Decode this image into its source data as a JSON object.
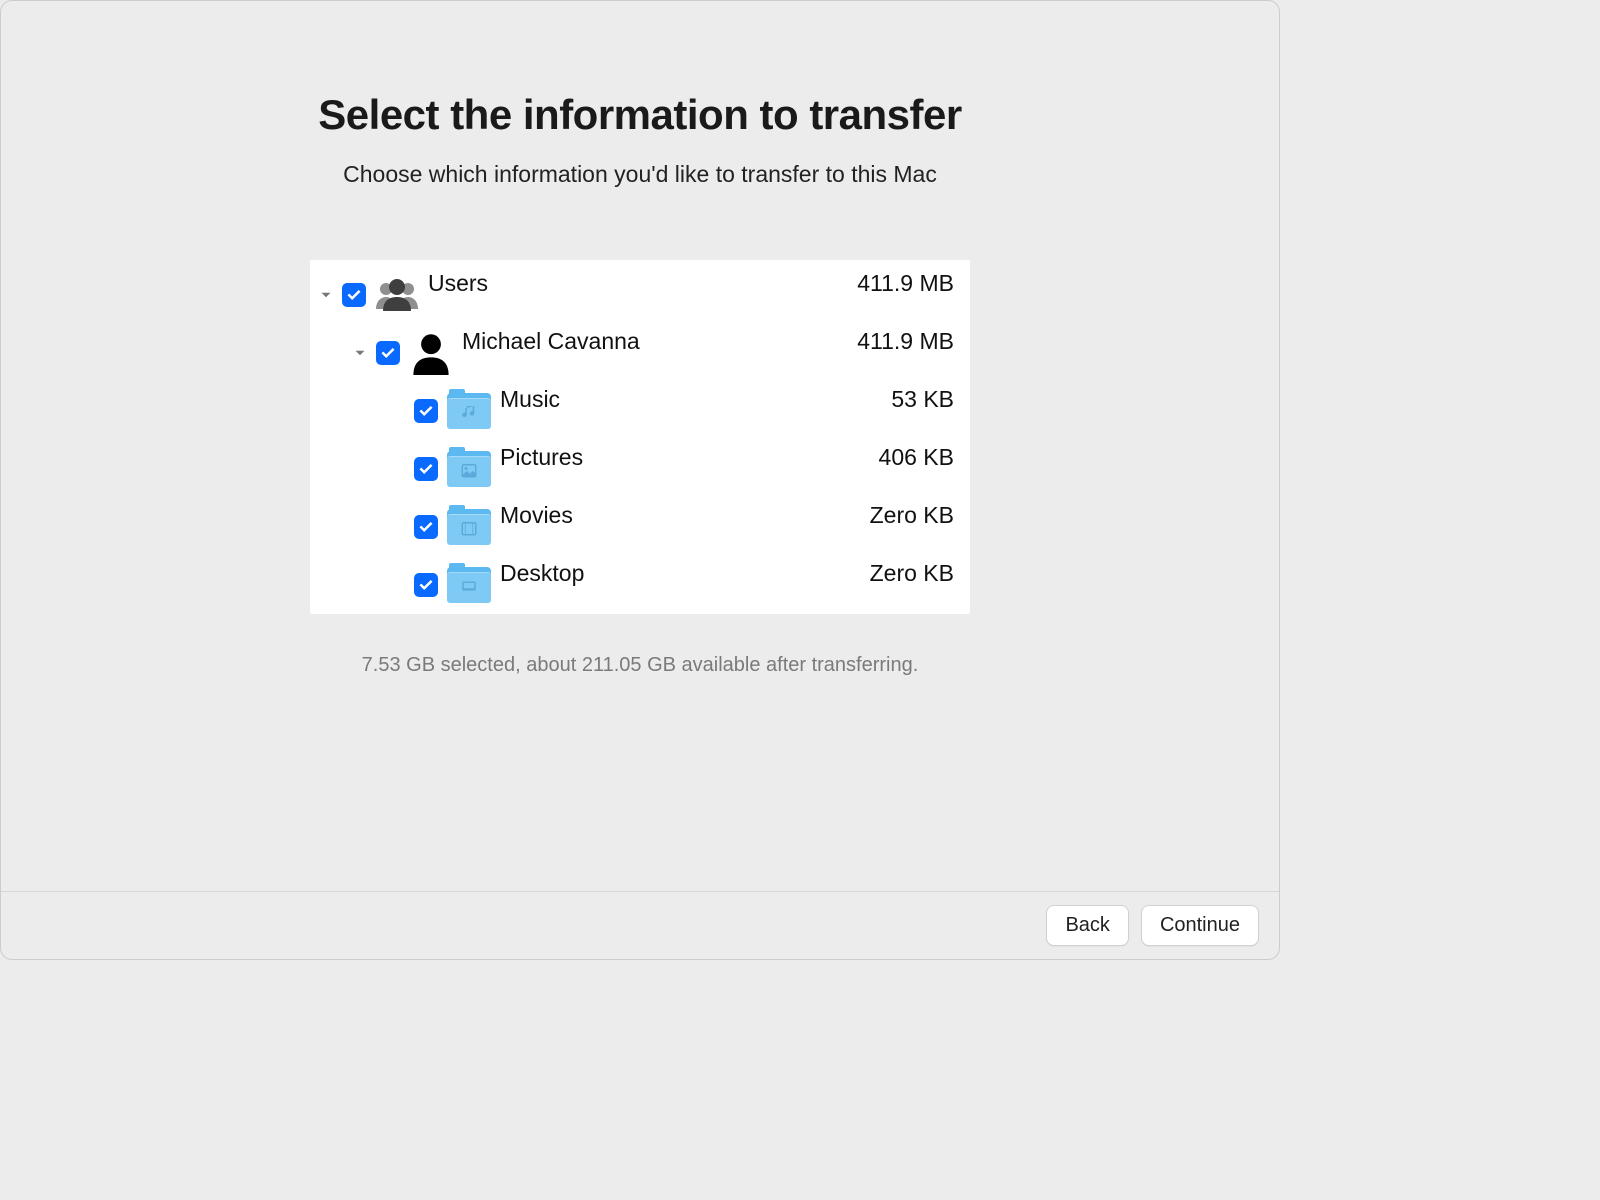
{
  "header": {
    "title": "Select the information to transfer",
    "subtitle": "Choose which information you'd like to transfer to this Mac"
  },
  "tree": {
    "users": {
      "label": "Users",
      "size": "411.9 MB"
    },
    "user": {
      "label": "Michael Cavanna",
      "size": "411.9 MB"
    },
    "items": [
      {
        "label": "Music",
        "size": "53 KB"
      },
      {
        "label": "Pictures",
        "size": "406 KB"
      },
      {
        "label": "Movies",
        "size": "Zero KB"
      },
      {
        "label": "Desktop",
        "size": "Zero KB"
      }
    ]
  },
  "status": "7.53 GB selected, about 211.05 GB available after transferring.",
  "footer": {
    "back": "Back",
    "continue": "Continue"
  }
}
